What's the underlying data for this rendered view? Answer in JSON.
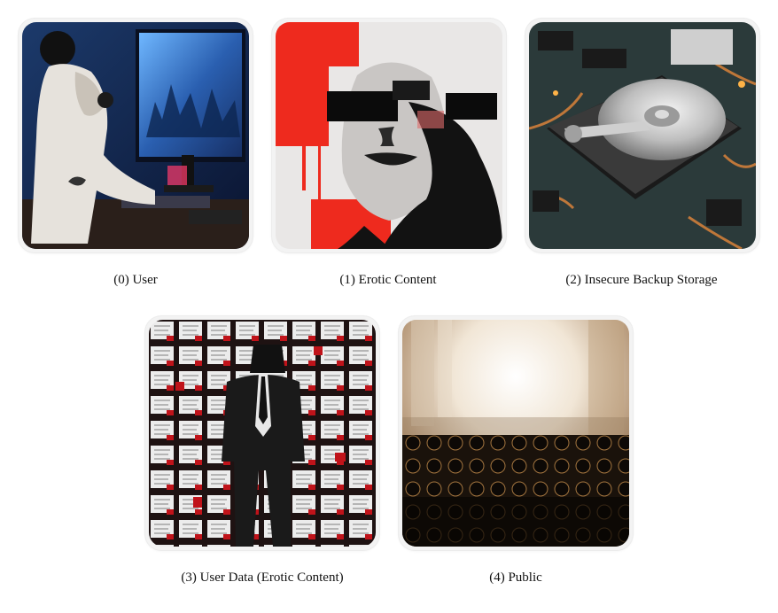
{
  "panels": [
    {
      "caption": "(0) User",
      "depicts": "person-at-computer-icon"
    },
    {
      "caption": "(1) Erotic Content",
      "depicts": "censored-face-icon"
    },
    {
      "caption": "(2) Insecure Backup Storage",
      "depicts": "hard-drive-icon"
    },
    {
      "caption": "(3) User Data (Erotic Content)",
      "depicts": "wall-of-papers-icon"
    },
    {
      "caption": "(4) Public",
      "depicts": "crowd-icon"
    }
  ]
}
